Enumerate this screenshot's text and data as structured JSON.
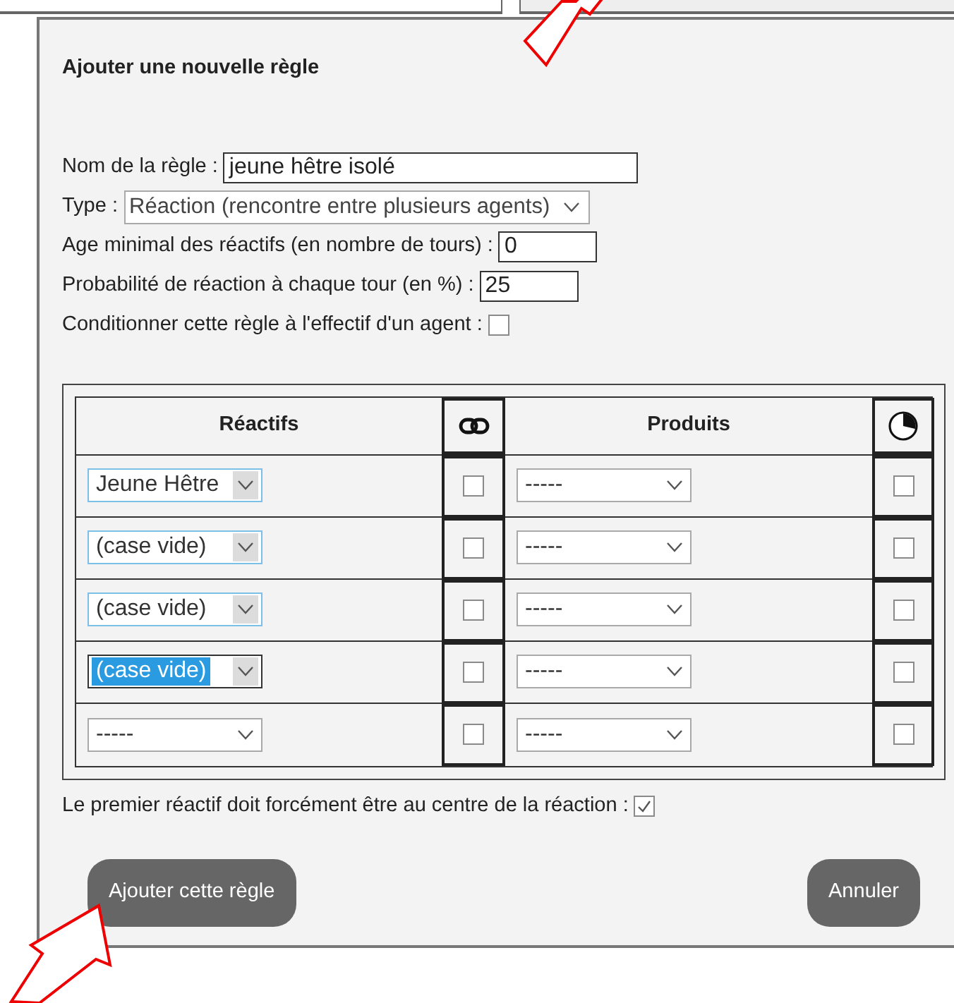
{
  "dialog": {
    "title": "Ajouter une nouvelle règle"
  },
  "fields": [
    {
      "kind": "text",
      "label": "Nom de la règle :",
      "value": "jeune hêtre isolé"
    },
    {
      "kind": "select",
      "label": "Type :",
      "value": "Réaction (rencontre entre plusieurs agents)"
    },
    {
      "kind": "text",
      "label": "Age minimal des réactifs (en nombre de tours) :",
      "value": "0"
    },
    {
      "kind": "text",
      "label": "Probabilité de réaction à chaque tour (en %) :",
      "value": "25"
    },
    {
      "kind": "checkbox",
      "label": "Conditionner cette règle à l'effectif d'un agent :",
      "checked": false
    }
  ],
  "table": {
    "columns": [
      "Réactifs",
      "Produits"
    ],
    "rows": [
      {
        "reactant": {
          "value": "Jeune Hêtre",
          "kind": "focused"
        },
        "linked": false,
        "product": "-----",
        "timed": false
      },
      {
        "reactant": {
          "value": "(case vide)",
          "kind": "focused"
        },
        "linked": false,
        "product": "-----",
        "timed": false
      },
      {
        "reactant": {
          "value": "(case vide)",
          "kind": "focused"
        },
        "linked": false,
        "product": "-----",
        "timed": false
      },
      {
        "reactant": {
          "value": "(case vide)",
          "kind": "highlighted"
        },
        "linked": false,
        "product": "-----",
        "timed": false
      },
      {
        "reactant": {
          "value": "-----",
          "kind": "plain"
        },
        "linked": false,
        "product": "-----",
        "timed": false
      }
    ]
  },
  "center_option": {
    "label": "Le premier réactif doit forcément être au centre de la réaction :",
    "checked": true
  },
  "buttons": [
    "Ajouter cette règle",
    "Annuler"
  ]
}
